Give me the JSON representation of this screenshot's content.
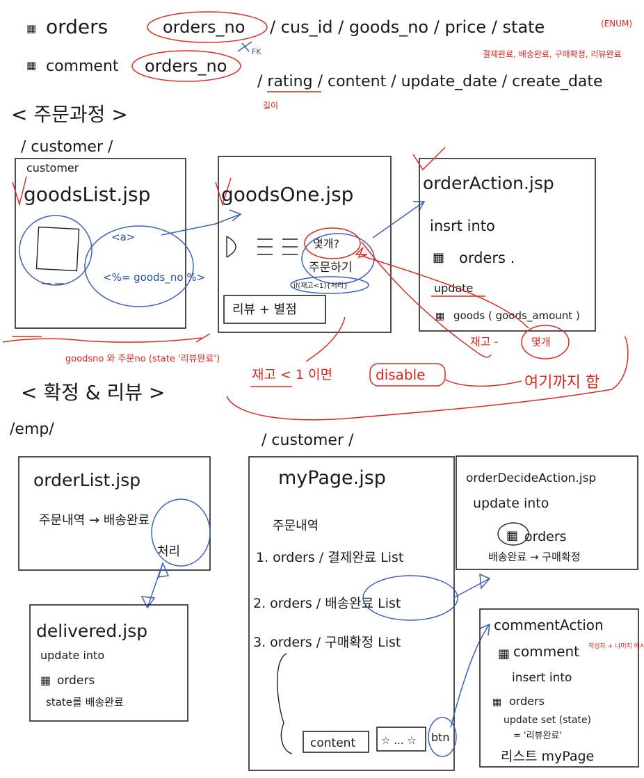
{
  "colors": {
    "ink": "#1a1a1a",
    "blue": "#2a4fa8",
    "red": "#d8261c"
  },
  "schema": {
    "orders_table": "orders",
    "orders_fields": "orders_no / cus_id / goods_no / price / state",
    "orders_pk": "orders_no",
    "orders_rest": "/ cus_id / goods_no / price / state",
    "enum_note": "(ENUM)",
    "state_values": "결제완료, 배송완료, 구매확정, 리뷰완료",
    "comment_table": "comment",
    "comment_pk": "orders_no",
    "fk_label": "FK",
    "comment_rest": "/ rating / content / update_date / create_date",
    "rating_note": "길이"
  },
  "section_order": {
    "title": "< 주문과정 >",
    "path": "/ customer /",
    "customer_label": "customer",
    "goods_list": {
      "title": "goodsList.jsp",
      "link_a": "<a>",
      "link_code": "<%= goods_no %>",
      "dash": "— —"
    },
    "goods_one": {
      "title": "goodsOne.jsp",
      "qty": "몇개?",
      "order_btn": "주문하기",
      "stock_check": "if(재고<1){처리}",
      "review": "리뷰 + 별점"
    },
    "order_action": {
      "title": "orderAction.jsp",
      "line1": "insrt into",
      "line2": "orders .",
      "line3": "update",
      "line4": "goods ( goods_amount )",
      "stock_note": "재고 -",
      "qty_note": "몇개"
    },
    "join_note": "goodsno 와 주문no (state '리뷰완료')",
    "disable_note": "재고 < 1 이면",
    "disable_word": "disable",
    "back_note": "여기까지 함"
  },
  "section_review": {
    "title": "< 확정 & 리뷰 >",
    "emp_path": "/emp/",
    "customer_path": "/ customer /",
    "order_list": {
      "title": "orderList.jsp",
      "line1": "주문내역 → 배송완료",
      "line2": "처리"
    },
    "delivered": {
      "title": "delivered.jsp",
      "line1": "update into",
      "line2": "orders",
      "line3": "state를 배송완료"
    },
    "my_page": {
      "title": "myPage.jsp",
      "heading": "주문내역",
      "item1": "1. orders / 결제완료 List",
      "item2": "2. orders / 배송완료 List",
      "item3": "3. orders / 구매확정 List",
      "content_box": "content",
      "stars": "☆ ... ☆",
      "btn": "btn"
    },
    "order_decide": {
      "title": "orderDecideAction.jsp",
      "line1": "update into",
      "line2": "orders",
      "line3": "배송완료 → 구매확정"
    },
    "comment_action": {
      "title": "commentAction",
      "line1": "comment",
      "side_note": "작성자 + 나머지 에서...",
      "line2": "insert into",
      "line3": "orders",
      "line4": "update set (state)",
      "line5": "= '리뷰완료'",
      "line6": "리스트  myPage"
    }
  }
}
